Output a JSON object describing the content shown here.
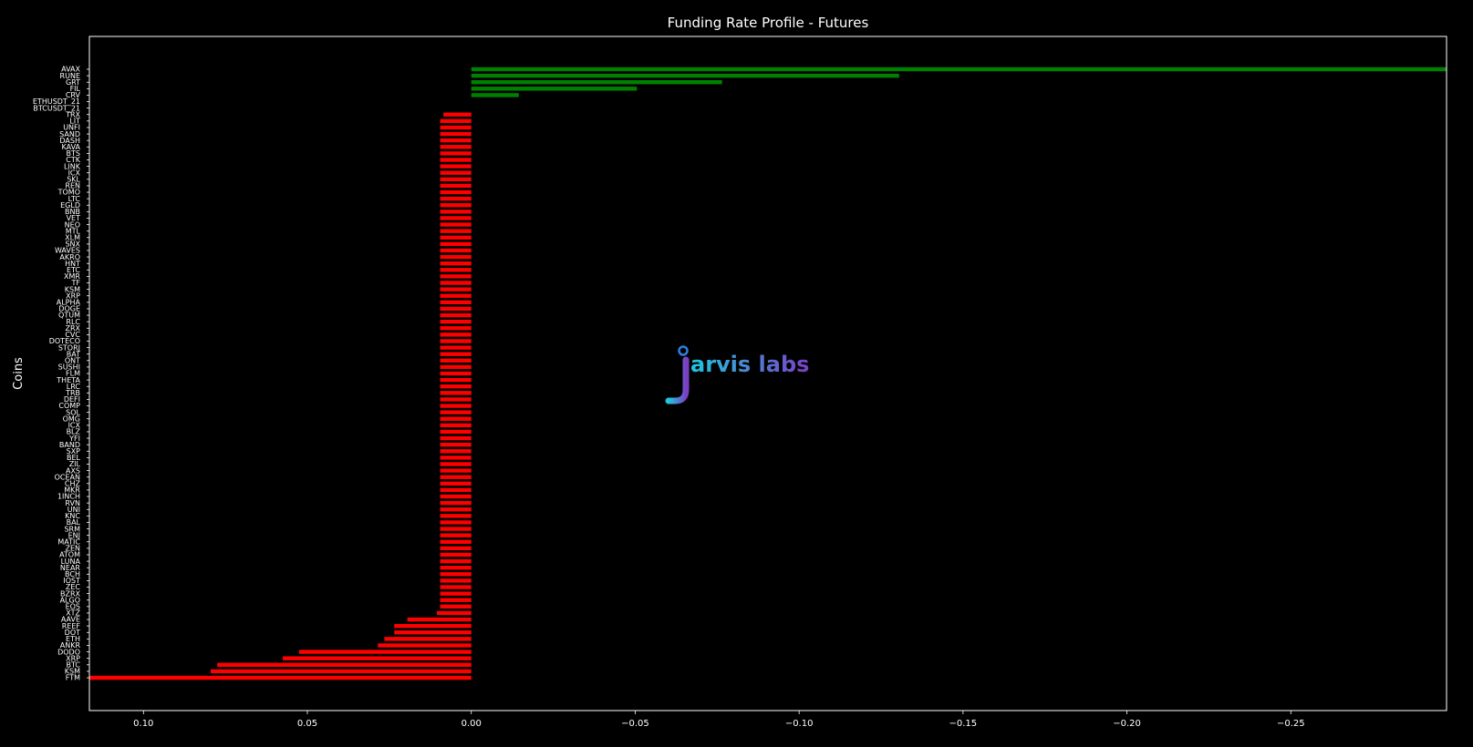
{
  "chart_data": {
    "type": "bar",
    "orientation": "horizontal",
    "title": "Funding Rate Profile - Futures",
    "xlabel": "",
    "ylabel": "Coins",
    "x_axis_inverted": true,
    "xlim": [
      0.1165,
      -0.2975
    ],
    "xticks": [
      "0.10",
      "0.05",
      "0.00",
      "−0.05",
      "−0.10",
      "−0.15",
      "−0.20",
      "−0.25"
    ],
    "xtick_values": [
      0.1,
      0.05,
      0.0,
      -0.05,
      -0.1,
      -0.15,
      -0.2,
      -0.25
    ],
    "grid": false,
    "colors": {
      "background": "#000000",
      "positive": "#ff0000",
      "negative": "#008000",
      "text": "#ffffff",
      "frame": "#ffffff"
    },
    "categories": [
      "AVAX",
      "RUNE",
      "GRT",
      "FIL",
      "CRV",
      "ETHUSDT_210625",
      "BTCUSDT_210625",
      "TRX",
      "LIT",
      "UNFI",
      "SAND",
      "DASH",
      "KAVA",
      "BTS",
      "CTK",
      "LINK",
      "ICX",
      "SKL",
      "REN",
      "TOMO",
      "LTC",
      "EGLD",
      "BNB",
      "VET",
      "NEO",
      "MTL",
      "XLM",
      "SNX",
      "WAVES",
      "AKRO",
      "HNT",
      "ETC",
      "XMR",
      "TF",
      "KSM",
      "XRP",
      "ALPHA",
      "DOGE",
      "QTUM",
      "RLC",
      "ZRX",
      "CVC",
      "DOTECO",
      "STORJ",
      "BAT",
      "ONT",
      "SUSHI",
      "FLM",
      "THETA",
      "LRC",
      "TRB",
      "DEFI",
      "COMP",
      "SOL",
      "OMG",
      "ICX2",
      "BLZ",
      "YFI",
      "BAND",
      "SXP",
      "BEL",
      "ZIL",
      "AXS",
      "OCEAN",
      "CHZ",
      "MKR",
      "1INCH",
      "RVN",
      "UNI",
      "KNC",
      "BAL",
      "SRM",
      "ENJ",
      "MATIC",
      "ZEN",
      "ATOM",
      "LUNA",
      "NEAR",
      "BCH",
      "IOST",
      "ZEC",
      "BZRX",
      "ALGO",
      "EOS",
      "XTZ",
      "AAVE",
      "REEF",
      "DOT",
      "ETH",
      "ANKR",
      "DODO",
      "XRPB",
      "BTC",
      "KSM2",
      "FTM"
    ],
    "category_labels": [
      "AVAX",
      "RUNE",
      "GRT",
      "FIL",
      "CRV",
      "ETHUSDT_21",
      "BTCUSDT_21",
      "TRX",
      "LIT",
      "UNFI",
      "SAND",
      "DASH",
      "KAVA",
      "BTS",
      "CTK",
      "LINK",
      "ICX",
      "SKL",
      "REN",
      "TOMO",
      "LTC",
      "EGLD",
      "BNB",
      "VET",
      "NEO",
      "MTL",
      "XLM",
      "SNX",
      "WAVES",
      "AKRO",
      "HNT",
      "ETC",
      "XMR",
      "TF",
      "KSM",
      "XRP",
      "ALPHA",
      "DOGE",
      "QTUM",
      "RLC",
      "ZRX",
      "CVC",
      "DOTECO",
      "STORJ",
      "BAT",
      "ONT",
      "SUSHI",
      "FLM",
      "THETA",
      "LRC",
      "TRB",
      "DEFI",
      "COMP",
      "SOL",
      "OMG",
      "ICX",
      "BLZ",
      "YFI",
      "BAND",
      "SXP",
      "BEL",
      "ZIL",
      "AXS",
      "OCEAN",
      "CHZ",
      "MKR",
      "1INCH",
      "RVN",
      "UNI",
      "KNC",
      "BAL",
      "SRM",
      "ENJ",
      "MATIC",
      "ZEN",
      "ATOM",
      "LUNA",
      "NEAR",
      "BCH",
      "IOST",
      "ZEC",
      "BZRX",
      "ALGO",
      "EOS",
      "XTZ",
      "AAVE",
      "REEF",
      "DOT",
      "ETH",
      "ANKR",
      "DODO",
      "XRP",
      "BTC",
      "KSM",
      "FTM"
    ],
    "values": [
      -0.2975,
      -0.1305,
      -0.0765,
      -0.0505,
      -0.0145,
      0.0,
      0.0,
      0.0085,
      0.0095,
      0.0095,
      0.0095,
      0.0095,
      0.0095,
      0.0095,
      0.0095,
      0.0095,
      0.0095,
      0.0095,
      0.0095,
      0.0095,
      0.0095,
      0.0095,
      0.0095,
      0.0095,
      0.0095,
      0.0095,
      0.0095,
      0.0095,
      0.0095,
      0.0095,
      0.0095,
      0.0095,
      0.0095,
      0.0095,
      0.0095,
      0.0095,
      0.0095,
      0.0095,
      0.0095,
      0.0095,
      0.0095,
      0.0095,
      0.0095,
      0.0095,
      0.0095,
      0.0095,
      0.0095,
      0.0095,
      0.0095,
      0.0095,
      0.0095,
      0.0095,
      0.0095,
      0.0095,
      0.0095,
      0.0095,
      0.0095,
      0.0095,
      0.0095,
      0.0095,
      0.0095,
      0.0095,
      0.0095,
      0.0095,
      0.0095,
      0.0095,
      0.0095,
      0.0095,
      0.0095,
      0.0095,
      0.0095,
      0.0095,
      0.0095,
      0.0095,
      0.0095,
      0.0095,
      0.0095,
      0.0095,
      0.0095,
      0.0095,
      0.0095,
      0.0095,
      0.0095,
      0.0095,
      0.0105,
      0.0195,
      0.0235,
      0.0235,
      0.0265,
      0.0285,
      0.0525,
      0.0575,
      0.0775,
      0.0795,
      0.1165
    ]
  },
  "watermark": {
    "name": "jarvis labs",
    "brand_gradient": [
      "#1ec8e0",
      "#7b3fc4"
    ]
  }
}
